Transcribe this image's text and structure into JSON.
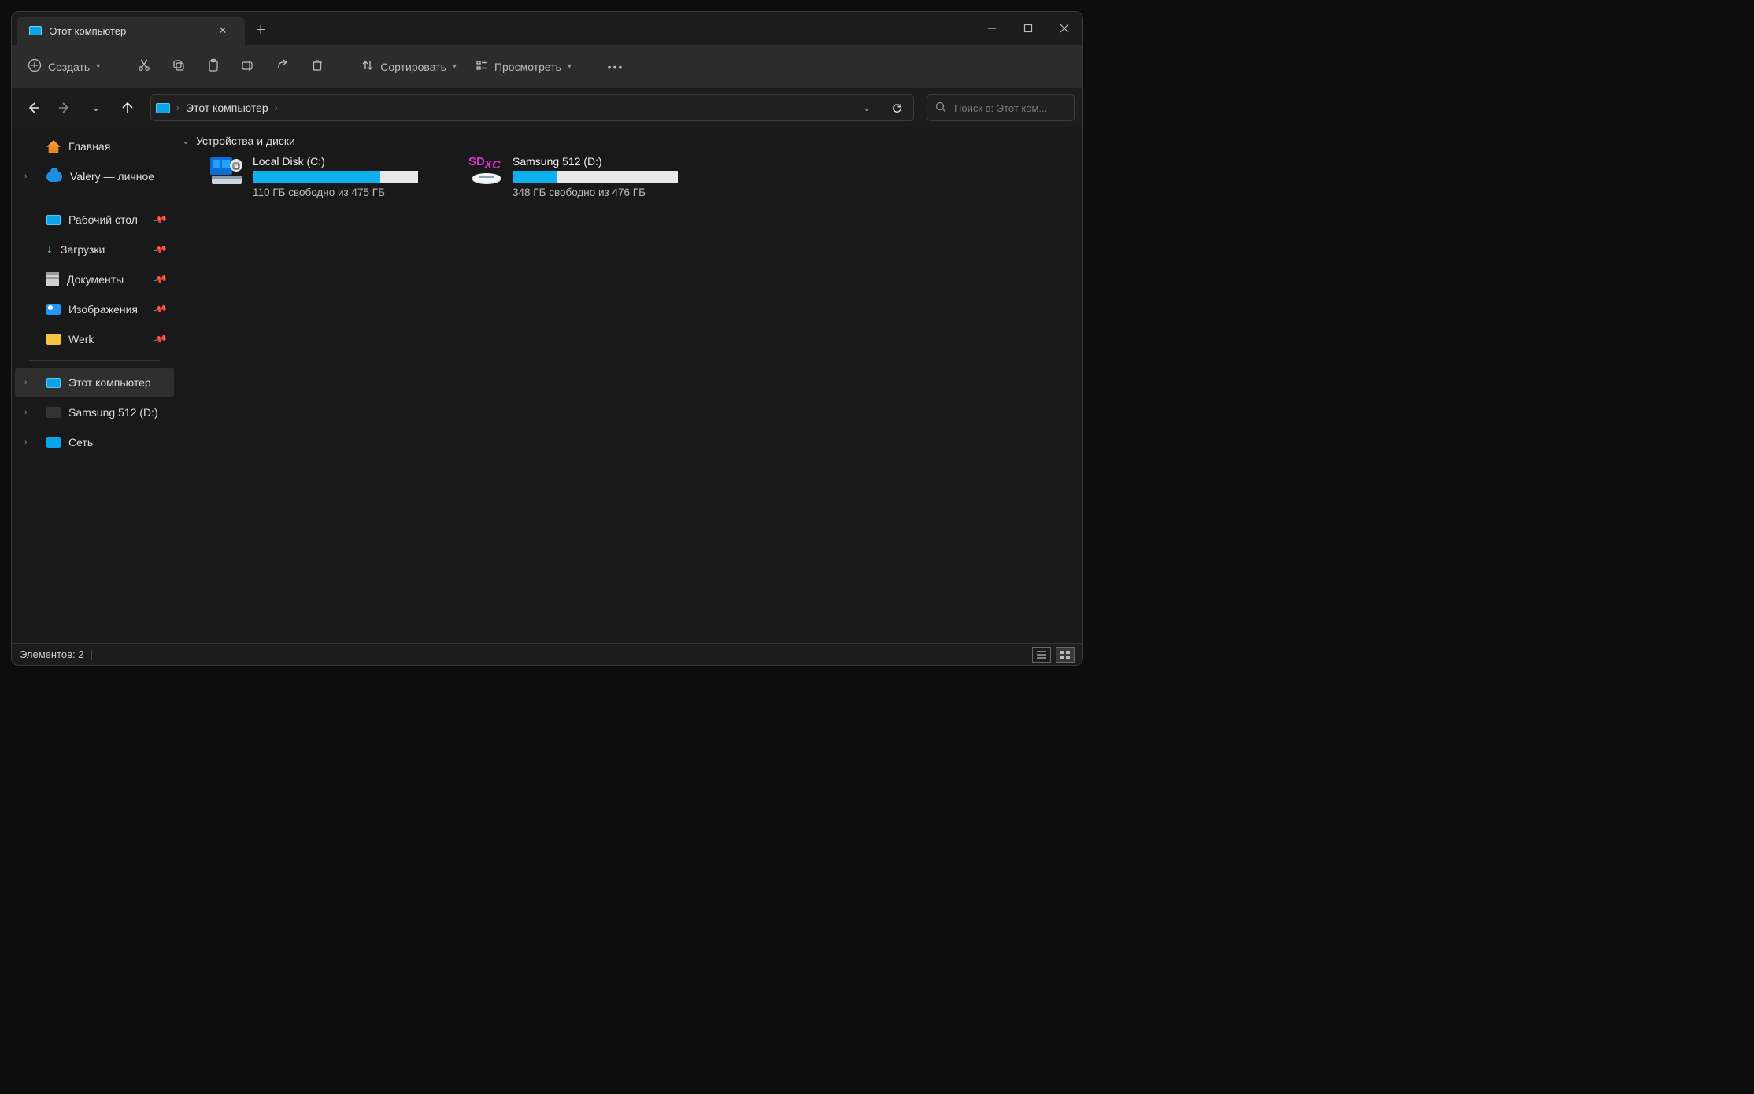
{
  "tab": {
    "title": "Этот компьютер"
  },
  "toolbar": {
    "create": "Создать",
    "sort": "Сортировать",
    "view": "Просмотреть"
  },
  "breadcrumb": {
    "root": "Этот компьютер"
  },
  "search": {
    "placeholder": "Поиск в: Этот ком..."
  },
  "sidebar": {
    "home": "Главная",
    "onedrive": "Valery — личное",
    "desktop": "Рабочий стол",
    "downloads": "Загрузки",
    "documents": "Документы",
    "pictures": "Изображения",
    "werk": "Werk",
    "thispc": "Этот компьютер",
    "samsung": "Samsung 512 (D:)",
    "network": "Сеть"
  },
  "group": {
    "title": "Устройства и диски"
  },
  "drives": [
    {
      "name": "Local Disk (C:)",
      "free_text": "110 ГБ свободно из 475 ГБ",
      "fill_pct": 77
    },
    {
      "name": "Samsung 512 (D:)",
      "free_text": "348 ГБ свободно из 476 ГБ",
      "fill_pct": 27
    }
  ],
  "status": {
    "count_text": "Элементов: 2"
  }
}
